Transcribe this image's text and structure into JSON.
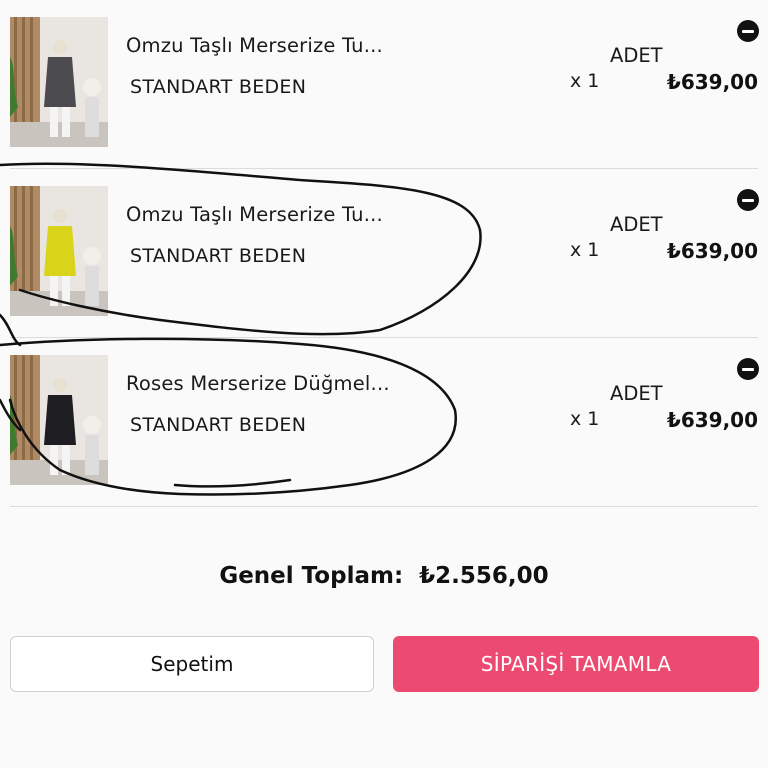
{
  "cart": {
    "items": [
      {
        "name": "Omzu Taşlı Merserize Tu...",
        "size": "STANDART BEDEN",
        "qty_label": "ADET",
        "qty": "x 1",
        "price": "₺639,00",
        "shirt_color": "#4b4b4f"
      },
      {
        "name": "Omzu Taşlı Merserize Tu...",
        "size": "STANDART BEDEN",
        "qty_label": "ADET",
        "qty": "x 1",
        "price": "₺639,00",
        "shirt_color": "#d9d319"
      },
      {
        "name": "Roses Merserize Düğmel...",
        "size": "STANDART BEDEN",
        "qty_label": "ADET",
        "qty": "x 1",
        "price": "₺639,00",
        "shirt_color": "#1e1e22"
      }
    ]
  },
  "summary": {
    "total_label": "Genel Toplam:",
    "total_value": "₺2.556,00"
  },
  "actions": {
    "cart_label": "Sepetim",
    "checkout_label": "SİPARİŞİ TAMAMLA"
  },
  "colors": {
    "accent": "#ec4a71",
    "background": "#fafafa"
  },
  "icons": {
    "remove": "minus-circle-icon"
  }
}
